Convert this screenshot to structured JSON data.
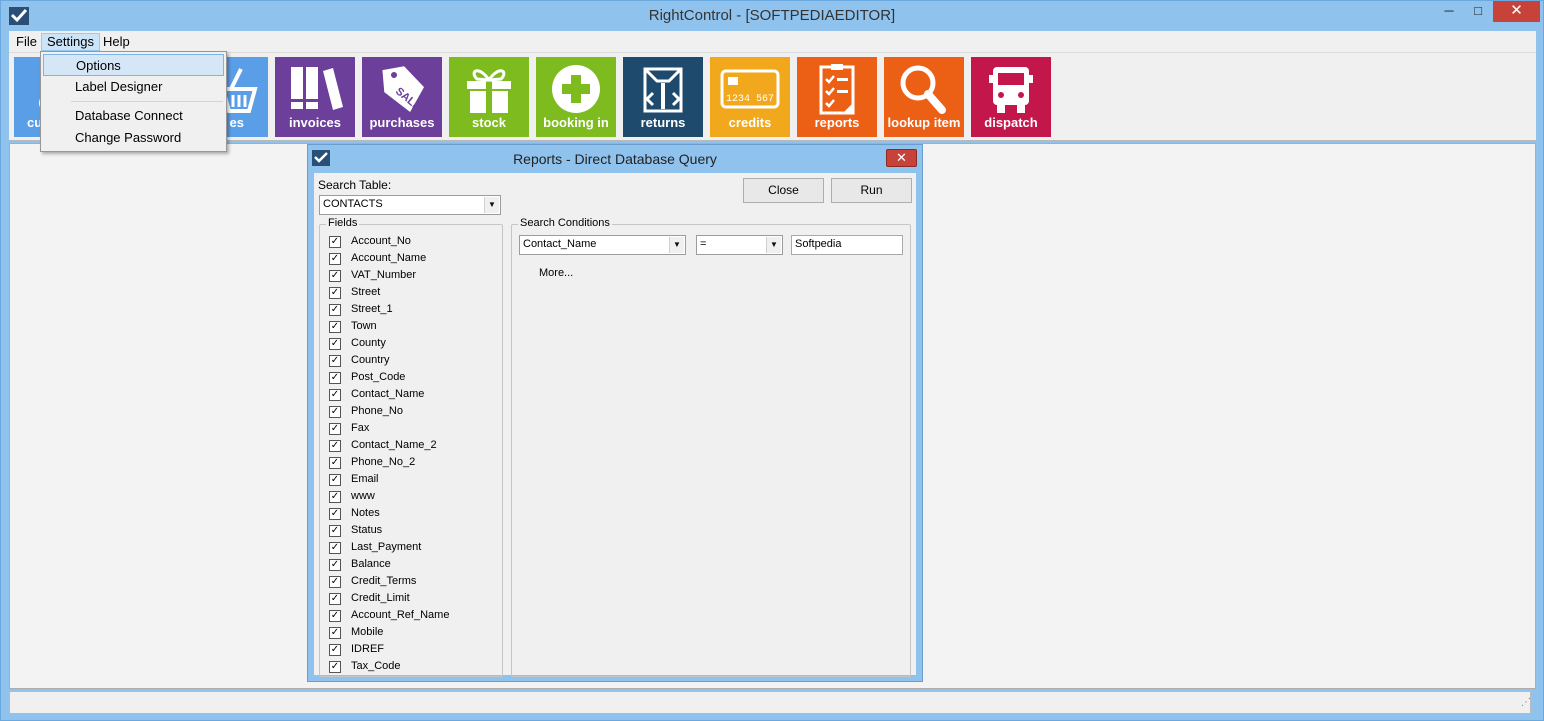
{
  "window": {
    "title": "RightControl - [SOFTPEDIAEDITOR]",
    "controls": {
      "minimize": "─",
      "maximize": "□",
      "close": "✕"
    }
  },
  "menubar": {
    "items": [
      {
        "label": "File"
      },
      {
        "label": "Settings"
      },
      {
        "label": "Help"
      }
    ]
  },
  "settings_menu": {
    "items": [
      {
        "label": "Options"
      },
      {
        "label": "Label Designer"
      },
      {
        "label": "Database Connect"
      },
      {
        "label": "Change Password"
      }
    ]
  },
  "toolbar": {
    "tiles": [
      {
        "label": "cu",
        "color": "#5b9ee8",
        "icon": "customers-icon"
      },
      {
        "label": "es",
        "color": "#5b9ee8",
        "icon": "basket-icon"
      },
      {
        "label": "invoices",
        "color": "#6b3f9a",
        "icon": "binders-icon"
      },
      {
        "label": "purchases",
        "color": "#6b3f9a",
        "icon": "sale-tag-icon"
      },
      {
        "label": "stock",
        "color": "#7dbb1f",
        "icon": "gift-icon"
      },
      {
        "label": "booking in",
        "color": "#7dbb1f",
        "icon": "plus-circle-icon"
      },
      {
        "label": "returns",
        "color": "#1e4a6e",
        "icon": "box-icon"
      },
      {
        "label": "credits",
        "color": "#f2a81d",
        "icon": "card-icon"
      },
      {
        "label": "reports",
        "color": "#ec6016",
        "icon": "clipboard-icon"
      },
      {
        "label": "lookup item",
        "color": "#ec6016",
        "icon": "magnifier-icon"
      },
      {
        "label": "dispatch",
        "color": "#c3164b",
        "icon": "truck-icon"
      }
    ],
    "card_number": "1234 567",
    "sale_tag_text": "SALE"
  },
  "dialog": {
    "title": "Reports - Direct Database Query",
    "search_table_label": "Search Table:",
    "search_table_value": "CONTACTS",
    "close_label": "Close",
    "run_label": "Run",
    "fields_group_label": "Fields",
    "fields": [
      "Account_No",
      "Account_Name",
      "VAT_Number",
      "Street",
      "Street_1",
      "Town",
      "County",
      "Country",
      "Post_Code",
      "Contact_Name",
      "Phone_No",
      "Fax",
      "Contact_Name_2",
      "Phone_No_2",
      "Email",
      "www",
      "Notes",
      "Status",
      "Last_Payment",
      "Balance",
      "Credit_Terms",
      "Credit_Limit",
      "Account_Ref_Name",
      "Mobile",
      "IDREF",
      "Tax_Code"
    ],
    "conditions_group_label": "Search Conditions",
    "condition": {
      "field": "Contact_Name",
      "operator": "=",
      "value": "Softpedia"
    },
    "more_label": "More..."
  }
}
